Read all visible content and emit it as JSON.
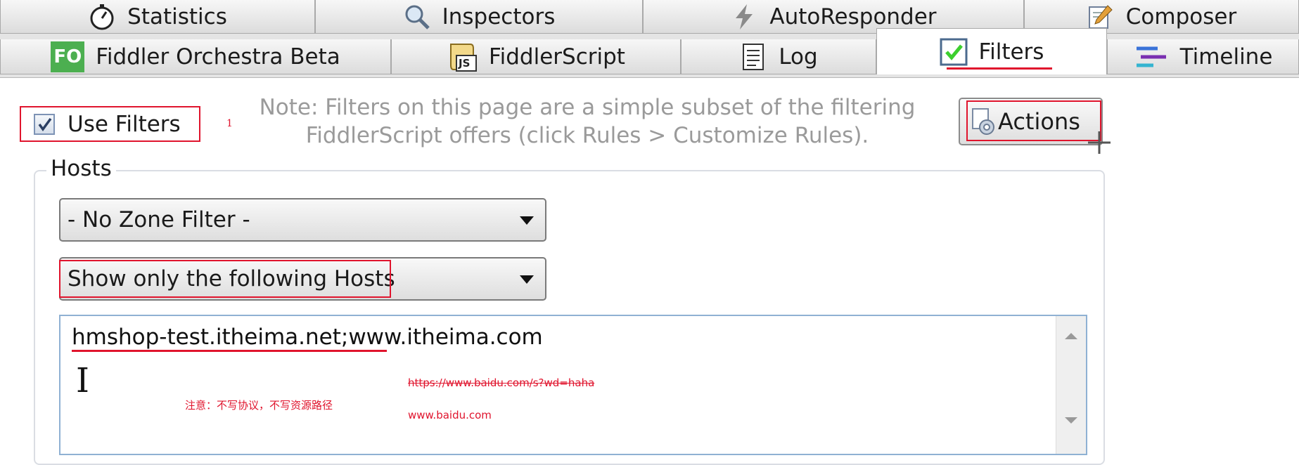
{
  "tabs_row1": [
    {
      "label": "Statistics",
      "icon": "stopwatch-icon"
    },
    {
      "label": "Inspectors",
      "icon": "magnifier-icon"
    },
    {
      "label": "AutoResponder",
      "icon": "lightning-icon"
    },
    {
      "label": "Composer",
      "icon": "pencil-note-icon"
    }
  ],
  "tabs_row2": [
    {
      "label": "Fiddler Orchestra Beta",
      "icon": "fo-logo-icon",
      "icon_text": "FO"
    },
    {
      "label": "FiddlerScript",
      "icon": "js-scroll-icon",
      "icon_text": "JS"
    },
    {
      "label": "Log",
      "icon": "log-page-icon"
    },
    {
      "label": "Filters",
      "icon": "check-icon",
      "active": true
    },
    {
      "label": "Timeline",
      "icon": "timeline-icon"
    }
  ],
  "filters": {
    "use_filters_label": "Use Filters",
    "use_filters_checked": true,
    "annotation_marker": "1",
    "note_line1": "Note: Filters on this page are a simple subset of the filtering",
    "note_line2": "FiddlerScript offers (click Rules > Customize Rules).",
    "actions_label": "Actions"
  },
  "hosts": {
    "legend": "Hosts",
    "zone_filter": "- No Zone Filter -",
    "host_filter": "Show only the following Hosts",
    "host_list": "hmshop-test.itheima.net;www.itheima.com"
  },
  "annotations": {
    "note_cn": "注意：不写协议，不写资源路径",
    "url_wrong": "https://www.baidu.com/s?wd=haha",
    "url_right": "www.baidu.com"
  },
  "colors": {
    "annotation_red": "#e0142d",
    "fo_green": "#4caf50"
  }
}
